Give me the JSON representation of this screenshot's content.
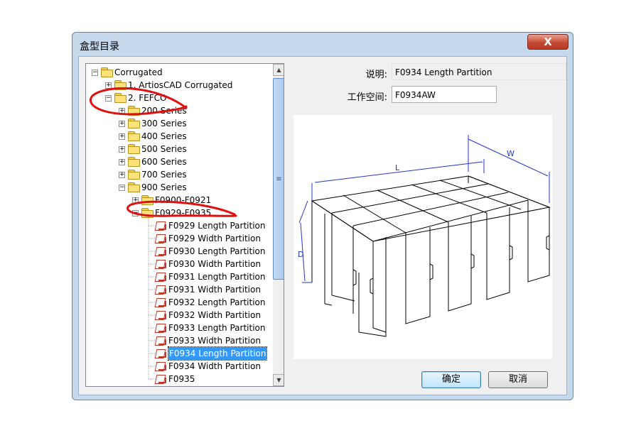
{
  "window": {
    "title": "盒型目录",
    "close_label": "X"
  },
  "tree": {
    "rows": [
      {
        "label": "Corrugated",
        "indent": 0,
        "expander": "−",
        "icon": "folder"
      },
      {
        "label": "1. ArtiosCAD Corrugated",
        "indent": 1,
        "expander": "+",
        "icon": "folder"
      },
      {
        "label": "2.  FEFCO",
        "indent": 1,
        "expander": "−",
        "icon": "folder"
      },
      {
        "label": "200 Series",
        "indent": 2,
        "expander": "+",
        "icon": "folder"
      },
      {
        "label": "300 Series",
        "indent": 2,
        "expander": "+",
        "icon": "folder"
      },
      {
        "label": "400 Series",
        "indent": 2,
        "expander": "+",
        "icon": "folder"
      },
      {
        "label": "500 Series",
        "indent": 2,
        "expander": "+",
        "icon": "folder"
      },
      {
        "label": "600 Series",
        "indent": 2,
        "expander": "+",
        "icon": "folder"
      },
      {
        "label": "700 Series",
        "indent": 2,
        "expander": "+",
        "icon": "folder"
      },
      {
        "label": "900 Series",
        "indent": 2,
        "expander": "−",
        "icon": "folder"
      },
      {
        "label": "F0900-F0921",
        "indent": 3,
        "expander": "+",
        "icon": "folder"
      },
      {
        "label": "F0929-F0935",
        "indent": 3,
        "expander": "−",
        "icon": "folder"
      },
      {
        "label": "F0929 Length Partition",
        "indent": 4,
        "expander": "",
        "icon": "doc"
      },
      {
        "label": "F0929 Width Partition",
        "indent": 4,
        "expander": "",
        "icon": "doc"
      },
      {
        "label": "F0930 Length Partition",
        "indent": 4,
        "expander": "",
        "icon": "doc"
      },
      {
        "label": "F0930 Width Partition",
        "indent": 4,
        "expander": "",
        "icon": "doc"
      },
      {
        "label": "F0931 Length Partition",
        "indent": 4,
        "expander": "",
        "icon": "doc"
      },
      {
        "label": "F0931 Width Partition",
        "indent": 4,
        "expander": "",
        "icon": "doc"
      },
      {
        "label": "F0932 Length Partition",
        "indent": 4,
        "expander": "",
        "icon": "doc"
      },
      {
        "label": "F0932 Width Partition",
        "indent": 4,
        "expander": "",
        "icon": "doc"
      },
      {
        "label": "F0933 Length Partition",
        "indent": 4,
        "expander": "",
        "icon": "doc"
      },
      {
        "label": "F0933 Width Partition",
        "indent": 4,
        "expander": "",
        "icon": "doc"
      },
      {
        "label": "F0934 Length Partition",
        "indent": 4,
        "expander": "",
        "icon": "doc",
        "selected": true
      },
      {
        "label": "F0934 Width Partition",
        "indent": 4,
        "expander": "",
        "icon": "doc"
      },
      {
        "label": "F0935",
        "indent": 4,
        "expander": "",
        "icon": "doc"
      }
    ]
  },
  "details": {
    "desc_label": "说明:",
    "desc_value": "F0934 Length Partition",
    "workspace_label": "工作空间:",
    "workspace_value": "F0934AW"
  },
  "preview": {
    "dim_length": "L",
    "dim_width": "W",
    "dim_depth": "D"
  },
  "buttons": {
    "ok": "确定",
    "cancel": "取消"
  },
  "colors": {
    "selection": "#3399ff",
    "dimension_lines": "#2233cc",
    "annotation": "#e01010"
  }
}
